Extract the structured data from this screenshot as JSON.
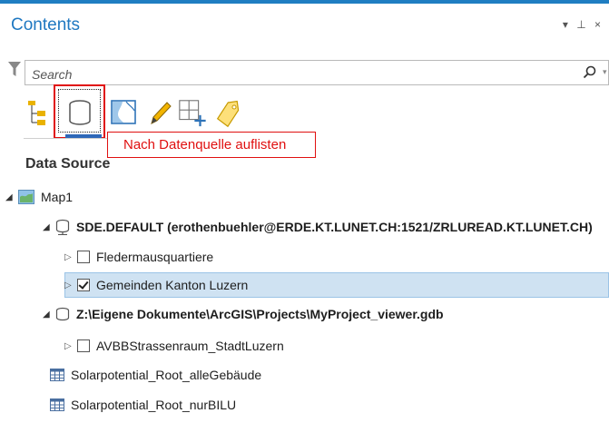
{
  "pane": {
    "title": "Contents",
    "controls": [
      "▾",
      "⊥",
      "×"
    ]
  },
  "search": {
    "placeholder": "Search"
  },
  "toolbar": {
    "buttons": [
      {
        "name": "list-by-drawing-order",
        "icon": "drawing-order-icon"
      },
      {
        "name": "list-by-data-source",
        "icon": "database-icon",
        "selected": true
      },
      {
        "name": "list-by-selection",
        "icon": "map-selection-icon"
      },
      {
        "name": "list-by-editing",
        "icon": "pencil-icon"
      },
      {
        "name": "list-by-snapping",
        "icon": "snapping-grid-icon"
      },
      {
        "name": "list-by-labeling",
        "icon": "label-tag-icon"
      }
    ],
    "tooltip": "Nach Datenquelle auflisten"
  },
  "section": {
    "heading": "Data Source"
  },
  "tree": {
    "map": {
      "label": "Map1"
    },
    "sources": [
      {
        "label": "SDE.DEFAULT (erothenbuehler@ERDE.KT.LUNET.CH:1521/ZRLUREAD.KT.LUNET.CH)",
        "items": [
          {
            "label": "Fledermausquartiere",
            "checked": false
          },
          {
            "label": "Gemeinden Kanton Luzern",
            "checked": true,
            "selected": true
          }
        ]
      },
      {
        "label": "Z:\\Eigene Dokumente\\ArcGIS\\Projects\\MyProject_viewer.gdb",
        "items": [
          {
            "label": "AVBBStrassenraum_StadtLuzern",
            "checked": false
          },
          {
            "label": "Solarpotential_Root_alleGebäude",
            "type": "table"
          },
          {
            "label": "Solarpotential_Root_nurBILU",
            "type": "table"
          }
        ]
      }
    ]
  },
  "colors": {
    "accent": "#1f78c1",
    "highlight_box": "#e01010",
    "selection_bg": "#cfe2f2"
  }
}
